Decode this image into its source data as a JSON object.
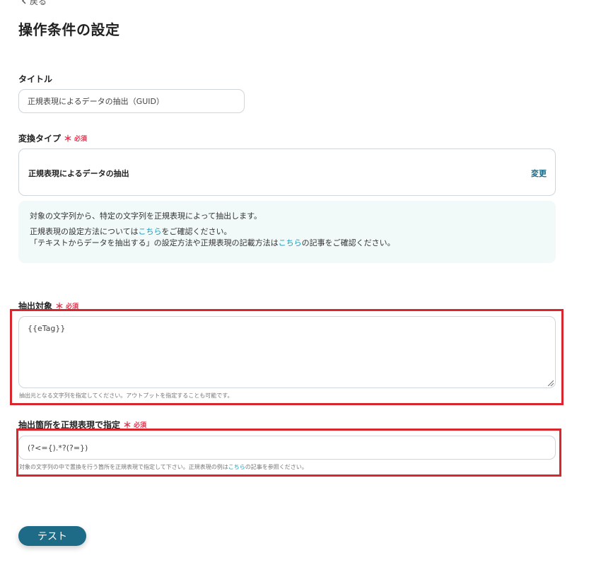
{
  "header": {
    "back_label": "戻る",
    "back_icon": "chevron-left-icon",
    "title": "操作条件の設定"
  },
  "title_field": {
    "label": "タイトル",
    "value": "正規表現によるデータの抽出（GUID）"
  },
  "conversion_type": {
    "label": "変換タイプ",
    "required_mark": "＊",
    "required_text": "必須",
    "selected": "正規表現によるデータの抽出",
    "change_label": "変更"
  },
  "info": {
    "line1": "対象の文字列から、特定の文字列を正規表現によって抽出します。",
    "line2_pre": "正規表現の設定方法については",
    "line2_link": "こちら",
    "line2_post": "をご確認ください。",
    "line3_pre": "「テキストからデータを抽出する」の設定方法や正規表現の記載方法は",
    "line3_link": "こちら",
    "line3_post": "の記事をご確認ください。"
  },
  "extract_target": {
    "label": "抽出対象",
    "required_mark": "＊",
    "required_text": "必須",
    "value": "{{eTag}}",
    "helper": "抽出元となる文字列を指定してください。アウトプットを指定することも可能です。"
  },
  "regex_field": {
    "label": "抽出箇所を正規表現で指定",
    "required_mark": "＊",
    "required_text": "必須",
    "value": "(?<={).*?(?=})",
    "helper_pre": "対象の文字列の中で置換を行う箇所を正規表現で指定して下さい。正規表現の例は",
    "helper_link": "こちら",
    "helper_post": "の記事を参照ください。"
  },
  "actions": {
    "test_label": "テスト"
  },
  "colors": {
    "accent": "#1d6b86",
    "link": "#1d9ab8",
    "required": "#e0314b",
    "highlight": "#d9262c",
    "info_bg": "#f1f9f9"
  }
}
